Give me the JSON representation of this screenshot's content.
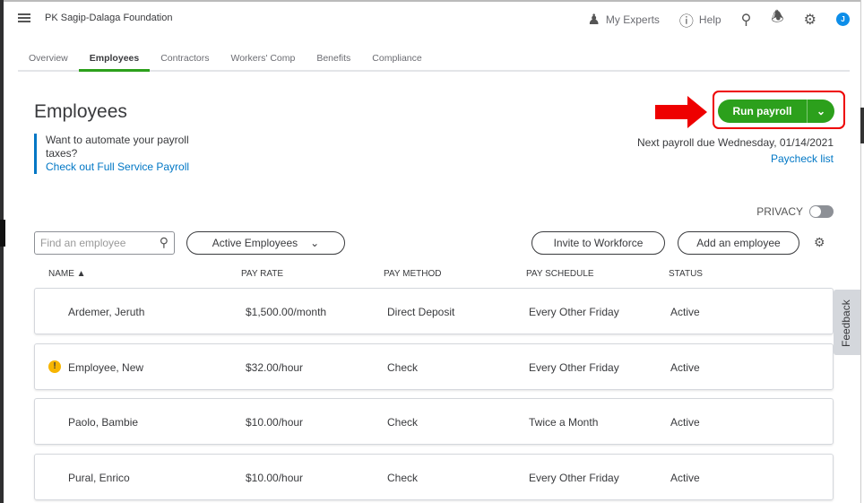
{
  "company": "PK Sagip-Dalaga Foundation",
  "toolbar": {
    "experts": "My Experts",
    "help": "Help",
    "avatar": "J"
  },
  "tabs": [
    "Overview",
    "Employees",
    "Contractors",
    "Workers' Comp",
    "Benefits",
    "Compliance"
  ],
  "title": "Employees",
  "promo": {
    "text": "Want to automate your payroll taxes?",
    "link": "Check out Full Service Payroll"
  },
  "run_payroll": "Run payroll",
  "next_payroll": "Next payroll due Wednesday, 01/14/2021",
  "paycheck_list": "Paycheck list",
  "privacy": "PRIVACY",
  "search_placeholder": "Find an employee",
  "filter": "Active Employees",
  "invite": "Invite to Workforce",
  "add": "Add an employee",
  "columns": [
    "NAME ▲",
    "PAY RATE",
    "PAY METHOD",
    "PAY SCHEDULE",
    "STATUS"
  ],
  "rows": [
    {
      "name": "Ardemer, Jeruth",
      "rate": "$1,500.00/month",
      "method": "Direct Deposit",
      "schedule": "Every Other Friday",
      "status": "Active"
    },
    {
      "name": "Employee, New",
      "rate": "$32.00/hour",
      "method": "Check",
      "schedule": "Every Other Friday",
      "status": "Active",
      "warn": "!"
    },
    {
      "name": "Paolo, Bambie",
      "rate": "$10.00/hour",
      "method": "Check",
      "schedule": "Twice a Month",
      "status": "Active"
    },
    {
      "name": "Pural, Enrico",
      "rate": "$10.00/hour",
      "method": "Check",
      "schedule": "Every Other Friday",
      "status": "Active"
    }
  ],
  "feedback": "Feedback"
}
